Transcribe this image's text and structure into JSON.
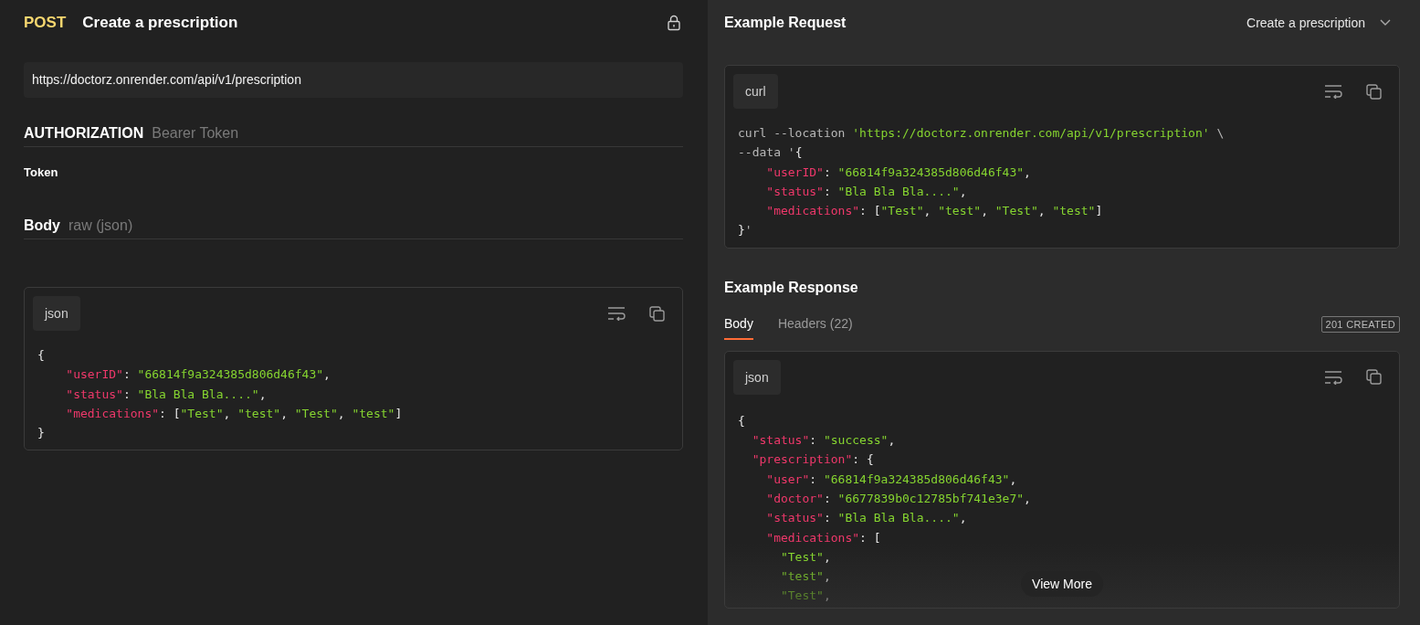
{
  "request": {
    "method": "POST",
    "title": "Create a prescription",
    "url": "https://doctorz.onrender.com/api/v1/prescription",
    "authorization": {
      "label": "AUTHORIZATION",
      "type": "Bearer Token",
      "field": "Token"
    },
    "body": {
      "label": "Body",
      "type": "raw (json)"
    },
    "code": {
      "language": "json",
      "lines": [
        [
          {
            "kind": "punctuation",
            "text": "{"
          }
        ],
        [
          {
            "kind": "key",
            "text": "    \"userID\""
          },
          {
            "kind": "punctuation",
            "text": ": "
          },
          {
            "kind": "string",
            "text": "\"66814f9a324385d806d46f43\""
          },
          {
            "kind": "punctuation",
            "text": ","
          }
        ],
        [
          {
            "kind": "key",
            "text": "    \"status\""
          },
          {
            "kind": "punctuation",
            "text": ": "
          },
          {
            "kind": "string",
            "text": "\"Bla Bla Bla....\""
          },
          {
            "kind": "punctuation",
            "text": ","
          }
        ],
        [
          {
            "kind": "key",
            "text": "    \"medications\""
          },
          {
            "kind": "punctuation",
            "text": ": ["
          },
          {
            "kind": "string",
            "text": "\"Test\""
          },
          {
            "kind": "punctuation",
            "text": ", "
          },
          {
            "kind": "string",
            "text": "\"test\""
          },
          {
            "kind": "punctuation",
            "text": ", "
          },
          {
            "kind": "string",
            "text": "\"Test\""
          },
          {
            "kind": "punctuation",
            "text": ", "
          },
          {
            "kind": "string",
            "text": "\"test\""
          },
          {
            "kind": "punctuation",
            "text": "]"
          }
        ],
        [
          {
            "kind": "punctuation",
            "text": "}"
          }
        ]
      ]
    }
  },
  "example_request": {
    "title": "Example Request",
    "selector": "Create a prescription",
    "code": {
      "language": "curl",
      "lines": [
        [
          {
            "kind": "command",
            "text": "curl --location "
          },
          {
            "kind": "string",
            "text": "'https://doctorz.onrender.com/api/v1/prescription'"
          },
          {
            "kind": "command",
            "text": " \\"
          }
        ],
        [
          {
            "kind": "command",
            "text": "--data '"
          },
          {
            "kind": "punctuation",
            "text": "{"
          }
        ],
        [
          {
            "kind": "key",
            "text": "    \"userID\""
          },
          {
            "kind": "punctuation",
            "text": ": "
          },
          {
            "kind": "string",
            "text": "\"66814f9a324385d806d46f43\""
          },
          {
            "kind": "punctuation",
            "text": ","
          }
        ],
        [
          {
            "kind": "key",
            "text": "    \"status\""
          },
          {
            "kind": "punctuation",
            "text": ": "
          },
          {
            "kind": "string",
            "text": "\"Bla Bla Bla....\""
          },
          {
            "kind": "punctuation",
            "text": ","
          }
        ],
        [
          {
            "kind": "key",
            "text": "    \"medications\""
          },
          {
            "kind": "punctuation",
            "text": ": ["
          },
          {
            "kind": "string",
            "text": "\"Test\""
          },
          {
            "kind": "punctuation",
            "text": ", "
          },
          {
            "kind": "string",
            "text": "\"test\""
          },
          {
            "kind": "punctuation",
            "text": ", "
          },
          {
            "kind": "string",
            "text": "\"Test\""
          },
          {
            "kind": "punctuation",
            "text": ", "
          },
          {
            "kind": "string",
            "text": "\"test\""
          },
          {
            "kind": "punctuation",
            "text": "]"
          }
        ],
        [
          {
            "kind": "punctuation",
            "text": "}"
          },
          {
            "kind": "command",
            "text": "'"
          }
        ]
      ]
    }
  },
  "example_response": {
    "title": "Example Response",
    "tabs": [
      {
        "label": "Body",
        "selected": true
      },
      {
        "label": "Headers (22)",
        "selected": false
      }
    ],
    "status_badge": "201 CREATED",
    "code": {
      "language": "json",
      "lines": [
        [
          {
            "kind": "punctuation",
            "text": "{"
          }
        ],
        [
          {
            "kind": "key",
            "text": "  \"status\""
          },
          {
            "kind": "punctuation",
            "text": ": "
          },
          {
            "kind": "string",
            "text": "\"success\""
          },
          {
            "kind": "punctuation",
            "text": ","
          }
        ],
        [
          {
            "kind": "key",
            "text": "  \"prescription\""
          },
          {
            "kind": "punctuation",
            "text": ": {"
          }
        ],
        [
          {
            "kind": "key",
            "text": "    \"user\""
          },
          {
            "kind": "punctuation",
            "text": ": "
          },
          {
            "kind": "string",
            "text": "\"66814f9a324385d806d46f43\""
          },
          {
            "kind": "punctuation",
            "text": ","
          }
        ],
        [
          {
            "kind": "key",
            "text": "    \"doctor\""
          },
          {
            "kind": "punctuation",
            "text": ": "
          },
          {
            "kind": "string",
            "text": "\"6677839b0c12785bf741e3e7\""
          },
          {
            "kind": "punctuation",
            "text": ","
          }
        ],
        [
          {
            "kind": "key",
            "text": "    \"status\""
          },
          {
            "kind": "punctuation",
            "text": ": "
          },
          {
            "kind": "string",
            "text": "\"Bla Bla Bla....\""
          },
          {
            "kind": "punctuation",
            "text": ","
          }
        ],
        [
          {
            "kind": "key",
            "text": "    \"medications\""
          },
          {
            "kind": "punctuation",
            "text": ": ["
          }
        ],
        [
          {
            "kind": "string",
            "text": "      \"Test\""
          },
          {
            "kind": "punctuation",
            "text": ","
          }
        ],
        [
          {
            "kind": "string",
            "text": "      \"test\""
          },
          {
            "kind": "punctuation",
            "text": ","
          }
        ],
        [
          {
            "kind": "string",
            "text": "      \"Test\""
          },
          {
            "kind": "punctuation",
            "text": ","
          }
        ]
      ]
    },
    "view_more": "View More"
  }
}
